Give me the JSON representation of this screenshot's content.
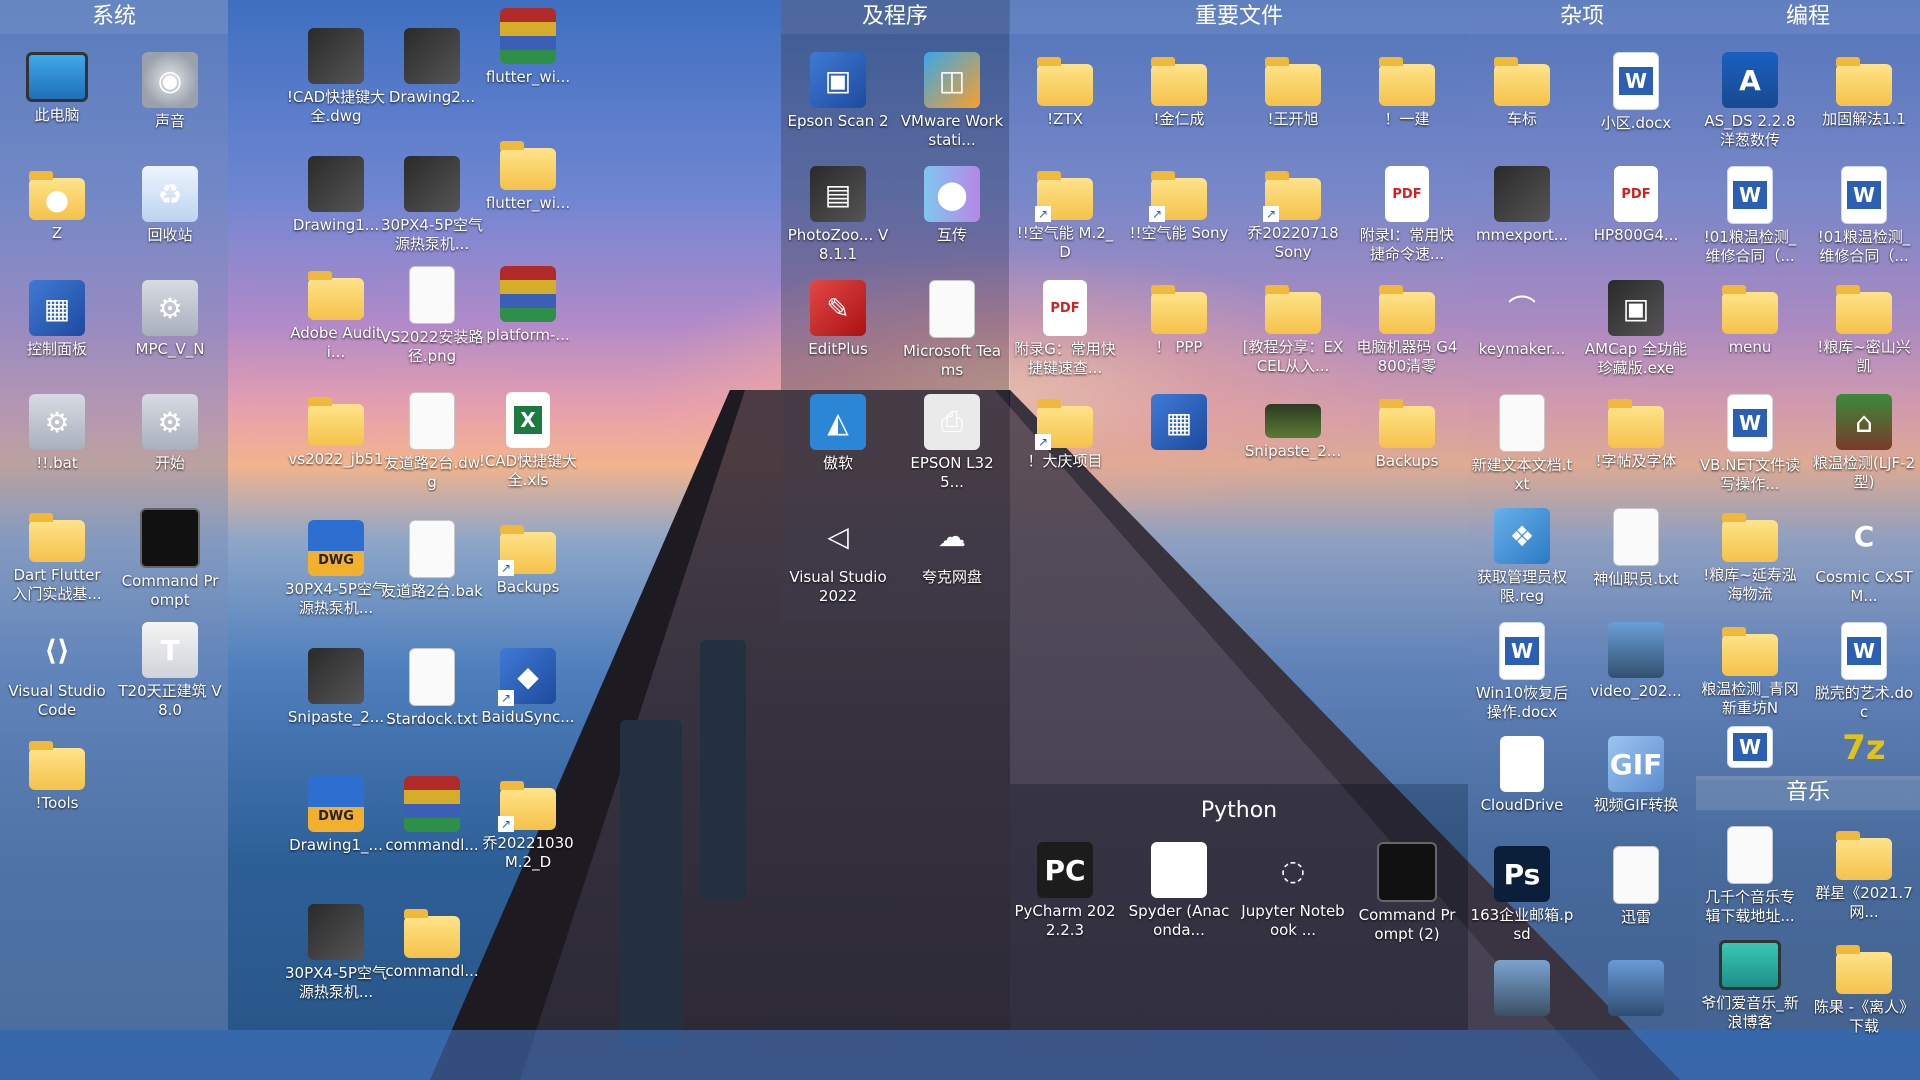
{
  "fences": [
    {
      "title": "系统"
    },
    {
      "title": "及程序"
    },
    {
      "title": "重要文件"
    },
    {
      "title": "杂项"
    },
    {
      "title": "编程"
    },
    {
      "title": "Python"
    },
    {
      "title": "音乐"
    }
  ],
  "system": [
    {
      "label": "此电脑",
      "icon": "monitor-icon"
    },
    {
      "label": "声音",
      "icon": "speaker-icon"
    },
    {
      "label": "Z",
      "icon": "user-folder-icon"
    },
    {
      "label": "回收站",
      "icon": "recycle-bin-icon"
    },
    {
      "label": "控制面板",
      "icon": "control-panel-icon"
    },
    {
      "label": "MPC_V_N",
      "icon": "gear-icon"
    },
    {
      "label": "!!.bat",
      "icon": "gear-icon"
    },
    {
      "label": "开始",
      "icon": "gear-icon"
    },
    {
      "label": "Dart Flutter 入门实战基...",
      "icon": "folder-icon"
    },
    {
      "label": "Command Prompt",
      "icon": "terminal-icon"
    },
    {
      "label": "Visual Studio Code",
      "icon": "vscode-icon"
    },
    {
      "label": "T20天正建筑 V8.0",
      "icon": "t20-icon"
    },
    {
      "label": "!Tools",
      "icon": "folder-icon"
    }
  ],
  "desktop": [
    {
      "label": "!CAD快捷键大全.dwg",
      "icon": "image-thumbnail-icon"
    },
    {
      "label": "Drawing2...",
      "icon": "image-thumbnail-icon"
    },
    {
      "label": "flutter_wi...",
      "icon": "winrar-icon"
    },
    {
      "label": "Drawing1...",
      "icon": "image-thumbnail-icon"
    },
    {
      "label": "30PX4-5P空气源热泵机...",
      "icon": "image-thumbnail-icon"
    },
    {
      "label": "flutter_wi...",
      "icon": "folder-icon"
    },
    {
      "label": "Adobe Auditi...",
      "icon": "folder-icon"
    },
    {
      "label": "VS2022安装路径.png",
      "icon": "image-thumbnail-icon"
    },
    {
      "label": "platform-...",
      "icon": "winrar-icon"
    },
    {
      "label": "vs2022_jb51",
      "icon": "folder-icon"
    },
    {
      "label": "友道路2台.dwg",
      "icon": "image-thumbnail-icon"
    },
    {
      "label": "!CAD快捷键大全.xls",
      "icon": "excel-icon"
    },
    {
      "label": "30PX4-5P空气源热泵机...",
      "icon": "dwg-icon"
    },
    {
      "label": "友道路2台.bak",
      "icon": "document-icon"
    },
    {
      "label": "Backups",
      "icon": "folder-shortcut-icon"
    },
    {
      "label": "Snipaste_2...",
      "icon": "image-thumbnail-icon"
    },
    {
      "label": "Stardock.txt",
      "icon": "document-icon"
    },
    {
      "label": "BaiduSync...",
      "icon": "baidusync-shortcut-icon"
    },
    {
      "label": "Drawing1_...",
      "icon": "dwg-icon"
    },
    {
      "label": "commandl...",
      "icon": "winrar-icon"
    },
    {
      "label": "乔20221030 M.2_D",
      "icon": "folder-shortcut-icon"
    },
    {
      "label": "30PX4-5P空气源热泵机...",
      "icon": "image-thumbnail-icon"
    },
    {
      "label": "commandl...",
      "icon": "folder-icon"
    }
  ],
  "programs": [
    {
      "label": "Epson Scan 2",
      "icon": "epson-scan-icon"
    },
    {
      "label": "VMware Workstati...",
      "icon": "vmware-icon"
    },
    {
      "label": "PhotoZoo... V8.1.1",
      "icon": "photozoom-icon"
    },
    {
      "label": "互传",
      "icon": "hutchuan-icon"
    },
    {
      "label": "EditPlus",
      "icon": "editplus-icon"
    },
    {
      "label": "Microsoft Teams",
      "icon": "document-icon"
    },
    {
      "label": "傲软",
      "icon": "aoruan-icon"
    },
    {
      "label": "EPSON L325...",
      "icon": "printer-icon"
    },
    {
      "label": "Visual Studio 2022",
      "icon": "visual-studio-icon"
    },
    {
      "label": "夸克网盘",
      "icon": "cloud-drive-icon"
    }
  ],
  "files": [
    {
      "label": "!ZTX",
      "icon": "folder-icon"
    },
    {
      "label": "!金仁成",
      "icon": "folder-icon"
    },
    {
      "label": "!王开旭",
      "icon": "folder-icon"
    },
    {
      "label": "！一建",
      "icon": "folder-icon"
    },
    {
      "label": "!!空气能 M.2_D",
      "icon": "folder-shortcut-icon"
    },
    {
      "label": "!!空气能 Sony",
      "icon": "folder-shortcut-icon"
    },
    {
      "label": "乔20220718 Sony",
      "icon": "folder-shortcut-icon"
    },
    {
      "label": "附录I：常用快捷命令速...",
      "icon": "pdf-icon"
    },
    {
      "label": "附录G：常用快捷键速查...",
      "icon": "pdf-icon"
    },
    {
      "label": "！ PPP",
      "icon": "folder-icon"
    },
    {
      "label": "[教程分享：EXCEL从入...",
      "icon": "folder-icon"
    },
    {
      "label": "电脑机器码 G4800清零",
      "icon": "folder-icon"
    },
    {
      "label": "！大庆项目",
      "icon": "folder-shortcut-icon"
    },
    {
      "label": "",
      "icon": "control-panel-icon"
    },
    {
      "label": "Snipaste_2...",
      "icon": "image-thumbnail-icon"
    },
    {
      "label": "Backups",
      "icon": "folder-icon"
    }
  ],
  "misc": [
    {
      "label": "车标",
      "icon": "folder-icon"
    },
    {
      "label": "小区.docx",
      "icon": "word-icon"
    },
    {
      "label": "mmexport...",
      "icon": "image-thumbnail-icon"
    },
    {
      "label": "HP800G4...",
      "icon": "pdf-icon"
    },
    {
      "label": "keymaker...",
      "icon": "keymaker-icon"
    },
    {
      "label": "AMCap 全功能珍藏版.exe",
      "icon": "amcap-icon"
    },
    {
      "label": "新建文本文档.txt",
      "icon": "document-icon"
    },
    {
      "label": "!字帖及字体",
      "icon": "folder-icon"
    },
    {
      "label": "获取管理员权限.reg",
      "icon": "registry-icon"
    },
    {
      "label": "神仙职员.txt",
      "icon": "document-icon"
    },
    {
      "label": "Win10恢复后操作.docx",
      "icon": "word-icon"
    },
    {
      "label": "video_202...",
      "icon": "video-thumbnail-icon"
    },
    {
      "label": "CloudDrive",
      "icon": "clouddrive-icon"
    },
    {
      "label": "视频GIF转换",
      "icon": "gif-icon"
    },
    {
      "label": "163企业邮箱.psd",
      "icon": "photoshop-icon"
    },
    {
      "label": "迅雷",
      "icon": "document-icon"
    },
    {
      "label": "",
      "icon": "image-thumbnail-icon"
    },
    {
      "label": "",
      "icon": "image-thumbnail-icon"
    }
  ],
  "coding": [
    {
      "label": "AS_DS 2.2.8 洋葱数传",
      "icon": "asds-icon"
    },
    {
      "label": "加固解法1.1",
      "icon": "folder-icon"
    },
    {
      "label": "!01粮温检测_维修合同（...",
      "icon": "word-icon"
    },
    {
      "label": "!01粮温检测_维修合同（...",
      "icon": "word-icon"
    },
    {
      "label": "menu",
      "icon": "folder-icon"
    },
    {
      "label": "!粮库~密山兴凯",
      "icon": "folder-icon"
    },
    {
      "label": "VB.NET文件读写操作...",
      "icon": "word-icon"
    },
    {
      "label": "粮温检测(LJF-2型)",
      "icon": "house-icon"
    },
    {
      "label": "!粮库~延寿泓海物流",
      "icon": "folder-icon"
    },
    {
      "label": "Cosmic CxSTM...",
      "icon": "cosmic-icon"
    },
    {
      "label": "粮温检测_青冈新重坊N",
      "icon": "folder-icon"
    },
    {
      "label": "脱壳的艺术.doc",
      "icon": "word-icon"
    },
    {
      "label": "",
      "icon": "word-icon"
    },
    {
      "label": "",
      "icon": "seven-z-icon"
    }
  ],
  "python": [
    {
      "label": "PyCharm 2022.2.3",
      "icon": "pycharm-icon"
    },
    {
      "label": "Spyder (Anaconda...",
      "icon": "spyder-icon"
    },
    {
      "label": "Jupyter Notebook ...",
      "icon": "jupyter-icon"
    },
    {
      "label": "Command Prompt (2)",
      "icon": "terminal-icon"
    }
  ],
  "music": [
    {
      "label": "几千个音乐专辑下载地址...",
      "icon": "document-icon"
    },
    {
      "label": "群星《2021.7网...",
      "icon": "folder-icon"
    },
    {
      "label": "爷们爱音乐_新浪博客",
      "icon": "monitor-icon"
    },
    {
      "label": "陈果 -《离人》下载",
      "icon": "folder-icon"
    }
  ]
}
